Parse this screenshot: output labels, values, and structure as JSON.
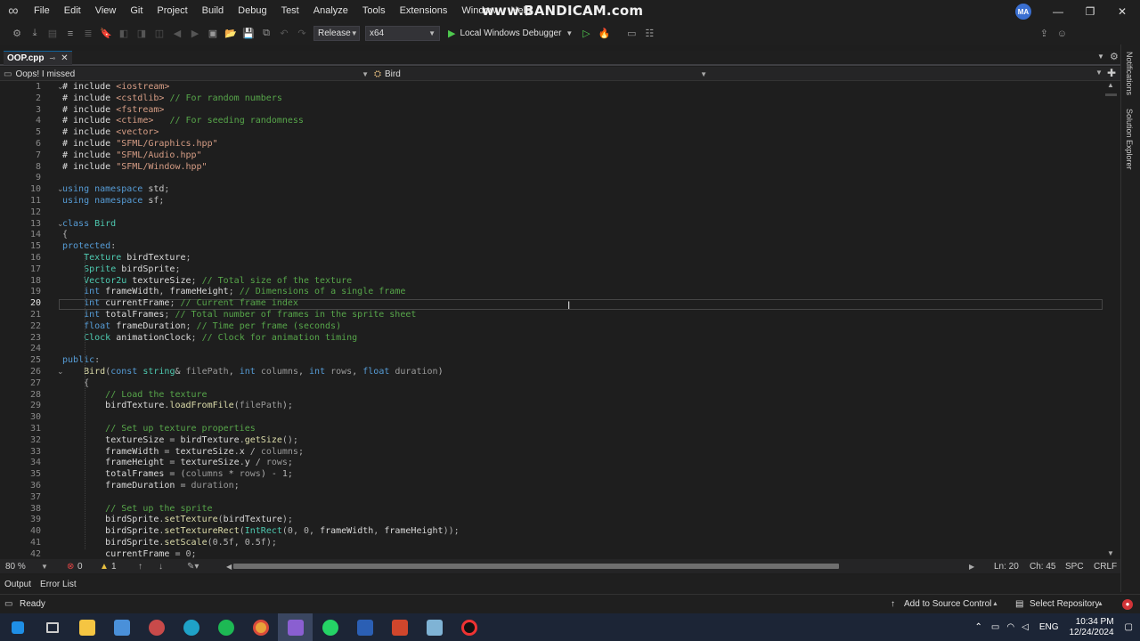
{
  "menubar": {
    "items": [
      "File",
      "Edit",
      "View",
      "Git",
      "Project",
      "Build",
      "Debug",
      "Test",
      "Analyze",
      "Tools",
      "Extensions",
      "Window",
      "Help"
    ],
    "avatar_initials": "MA",
    "watermark": "www.BANDICAM.com"
  },
  "toolbar": {
    "configuration": "Release",
    "platform": "x64",
    "debugger": "Local Windows Debugger"
  },
  "tab": {
    "label": "OOP.cpp"
  },
  "navbar": {
    "project": "Oops! I missed",
    "scope": "Bird"
  },
  "side_tabs": {
    "notifications": "Notifications",
    "solution_explorer": "Solution Explorer"
  },
  "editor": {
    "current_line": 20,
    "lines": [
      [
        [
          "t",
          "# include "
        ],
        [
          "s",
          "<iostream>"
        ]
      ],
      [
        [
          "t",
          "# include "
        ],
        [
          "s",
          "<cstdlib>"
        ],
        [
          "t",
          " "
        ],
        [
          "c",
          "// For random numbers"
        ]
      ],
      [
        [
          "t",
          "# include "
        ],
        [
          "s",
          "<fstream>"
        ]
      ],
      [
        [
          "t",
          "# include "
        ],
        [
          "s",
          "<ctime>"
        ],
        [
          "t",
          "   "
        ],
        [
          "c",
          "// For seeding randomness"
        ]
      ],
      [
        [
          "t",
          "# include "
        ],
        [
          "s",
          "<vector>"
        ]
      ],
      [
        [
          "t",
          "# include "
        ],
        [
          "s",
          "\"SFML/Graphics.hpp\""
        ]
      ],
      [
        [
          "t",
          "# include "
        ],
        [
          "s",
          "\"SFML/Audio.hpp\""
        ]
      ],
      [
        [
          "t",
          "# include "
        ],
        [
          "s",
          "\"SFML/Window.hpp\""
        ]
      ],
      [],
      [
        [
          "k",
          "using namespace "
        ],
        [
          "n",
          "std"
        ],
        [
          "p",
          ";"
        ]
      ],
      [
        [
          "k",
          "using namespace "
        ],
        [
          "n",
          "sf"
        ],
        [
          "p",
          ";"
        ]
      ],
      [],
      [
        [
          "k",
          "class "
        ],
        [
          "y",
          "Bird"
        ]
      ],
      [
        [
          "p",
          "{"
        ]
      ],
      [
        [
          "k",
          "protected"
        ],
        [
          "p",
          ":"
        ]
      ],
      [
        [
          "t",
          "    "
        ],
        [
          "y",
          "Texture"
        ],
        [
          "v",
          " birdTexture"
        ],
        [
          "p",
          ";"
        ]
      ],
      [
        [
          "t",
          "    "
        ],
        [
          "y",
          "Sprite"
        ],
        [
          "v",
          " birdSprite"
        ],
        [
          "p",
          ";"
        ]
      ],
      [
        [
          "t",
          "    "
        ],
        [
          "y",
          "Vector2u"
        ],
        [
          "v",
          " textureSize"
        ],
        [
          "p",
          "; "
        ],
        [
          "c",
          "// Total size of the texture"
        ]
      ],
      [
        [
          "t",
          "    "
        ],
        [
          "k",
          "int"
        ],
        [
          "v",
          " frameWidth"
        ],
        [
          "p",
          ", "
        ],
        [
          "v",
          "frameHeight"
        ],
        [
          "p",
          "; "
        ],
        [
          "c",
          "// Dimensions of a single frame"
        ]
      ],
      [
        [
          "t",
          "    "
        ],
        [
          "k",
          "int"
        ],
        [
          "v",
          " currentFrame"
        ],
        [
          "p",
          "; "
        ],
        [
          "c",
          "// Current frame index"
        ]
      ],
      [
        [
          "t",
          "    "
        ],
        [
          "k",
          "int"
        ],
        [
          "v",
          " totalFrames"
        ],
        [
          "p",
          "; "
        ],
        [
          "c",
          "// Total number of frames in the sprite sheet"
        ]
      ],
      [
        [
          "t",
          "    "
        ],
        [
          "k",
          "float"
        ],
        [
          "v",
          " frameDuration"
        ],
        [
          "p",
          "; "
        ],
        [
          "c",
          "// Time per frame (seconds)"
        ]
      ],
      [
        [
          "t",
          "    "
        ],
        [
          "y",
          "Clock"
        ],
        [
          "v",
          " animationClock"
        ],
        [
          "p",
          "; "
        ],
        [
          "c",
          "// Clock for animation timing"
        ]
      ],
      [],
      [
        [
          "k",
          "public"
        ],
        [
          "p",
          ":"
        ]
      ],
      [
        [
          "t",
          "    "
        ],
        [
          "f",
          "Bird"
        ],
        [
          "p",
          "("
        ],
        [
          "k",
          "const "
        ],
        [
          "y",
          "string"
        ],
        [
          "p",
          "& "
        ],
        [
          "a",
          "filePath"
        ],
        [
          "p",
          ", "
        ],
        [
          "k",
          "int "
        ],
        [
          "a",
          "columns"
        ],
        [
          "p",
          ", "
        ],
        [
          "k",
          "int "
        ],
        [
          "a",
          "rows"
        ],
        [
          "p",
          ", "
        ],
        [
          "k",
          "float "
        ],
        [
          "a",
          "duration"
        ],
        [
          "p",
          ")"
        ]
      ],
      [
        [
          "t",
          "    "
        ],
        [
          "p",
          "{"
        ]
      ],
      [
        [
          "t",
          "        "
        ],
        [
          "c",
          "// Load the texture"
        ]
      ],
      [
        [
          "t",
          "        "
        ],
        [
          "v",
          "birdTexture"
        ],
        [
          "p",
          "."
        ],
        [
          "f",
          "loadFromFile"
        ],
        [
          "p",
          "("
        ],
        [
          "a",
          "filePath"
        ],
        [
          "p",
          ");"
        ]
      ],
      [],
      [
        [
          "t",
          "        "
        ],
        [
          "c",
          "// Set up texture properties"
        ]
      ],
      [
        [
          "t",
          "        "
        ],
        [
          "v",
          "textureSize"
        ],
        [
          "p",
          " = "
        ],
        [
          "v",
          "birdTexture"
        ],
        [
          "p",
          "."
        ],
        [
          "f",
          "getSize"
        ],
        [
          "p",
          "();"
        ]
      ],
      [
        [
          "t",
          "        "
        ],
        [
          "v",
          "frameWidth"
        ],
        [
          "p",
          " = "
        ],
        [
          "v",
          "textureSize"
        ],
        [
          "p",
          "."
        ],
        [
          "v",
          "x"
        ],
        [
          "p",
          " / "
        ],
        [
          "a",
          "columns"
        ],
        [
          "p",
          ";"
        ]
      ],
      [
        [
          "t",
          "        "
        ],
        [
          "v",
          "frameHeight"
        ],
        [
          "p",
          " = "
        ],
        [
          "v",
          "textureSize"
        ],
        [
          "p",
          "."
        ],
        [
          "v",
          "y"
        ],
        [
          "p",
          " / "
        ],
        [
          "a",
          "rows"
        ],
        [
          "p",
          ";"
        ]
      ],
      [
        [
          "t",
          "        "
        ],
        [
          "v",
          "totalFrames"
        ],
        [
          "p",
          " = ("
        ],
        [
          "a",
          "columns"
        ],
        [
          "p",
          " * "
        ],
        [
          "a",
          "rows"
        ],
        [
          "p",
          ") - 1;"
        ]
      ],
      [
        [
          "t",
          "        "
        ],
        [
          "v",
          "frameDuration"
        ],
        [
          "p",
          " = "
        ],
        [
          "a",
          "duration"
        ],
        [
          "p",
          ";"
        ]
      ],
      [],
      [
        [
          "t",
          "        "
        ],
        [
          "c",
          "// Set up the sprite"
        ]
      ],
      [
        [
          "t",
          "        "
        ],
        [
          "v",
          "birdSprite"
        ],
        [
          "p",
          "."
        ],
        [
          "f",
          "setTexture"
        ],
        [
          "p",
          "("
        ],
        [
          "v",
          "birdTexture"
        ],
        [
          "p",
          ");"
        ]
      ],
      [
        [
          "t",
          "        "
        ],
        [
          "v",
          "birdSprite"
        ],
        [
          "p",
          "."
        ],
        [
          "f",
          "setTextureRect"
        ],
        [
          "p",
          "("
        ],
        [
          "y",
          "IntRect"
        ],
        [
          "p",
          "(0, 0, "
        ],
        [
          "v",
          "frameWidth"
        ],
        [
          "p",
          ", "
        ],
        [
          "v",
          "frameHeight"
        ],
        [
          "p",
          "));"
        ]
      ],
      [
        [
          "t",
          "        "
        ],
        [
          "v",
          "birdSprite"
        ],
        [
          "p",
          "."
        ],
        [
          "f",
          "setScale"
        ],
        [
          "p",
          "(0.5f, 0.5f);"
        ]
      ],
      [
        [
          "t",
          "        "
        ],
        [
          "v",
          "currentFrame"
        ],
        [
          "p",
          " = 0;"
        ]
      ]
    ]
  },
  "hscroll": {
    "zoom": "80 %",
    "errors": "0",
    "warnings": "1"
  },
  "position": {
    "line": "Ln: 20",
    "col": "Ch: 45",
    "spacing": "SPC",
    "eol": "CRLF"
  },
  "bottom_tabs": [
    "Output",
    "Error List"
  ],
  "status": {
    "ready": "Ready",
    "source_control": "Add to Source Control",
    "repository": "Select Repository"
  },
  "tray": {
    "lang": "ENG",
    "time": "10:34 PM",
    "date": "12/24/2024"
  },
  "colors": {
    "t": "#dadada",
    "k": "#569cd6",
    "s": "#d69d85",
    "c": "#57a64a",
    "y": "#4ec9b0",
    "v": "#dadada",
    "p": "#b4b4b4",
    "n": "#c8c8c8",
    "f": "#dcdcaa",
    "a": "#9a9a9a"
  }
}
